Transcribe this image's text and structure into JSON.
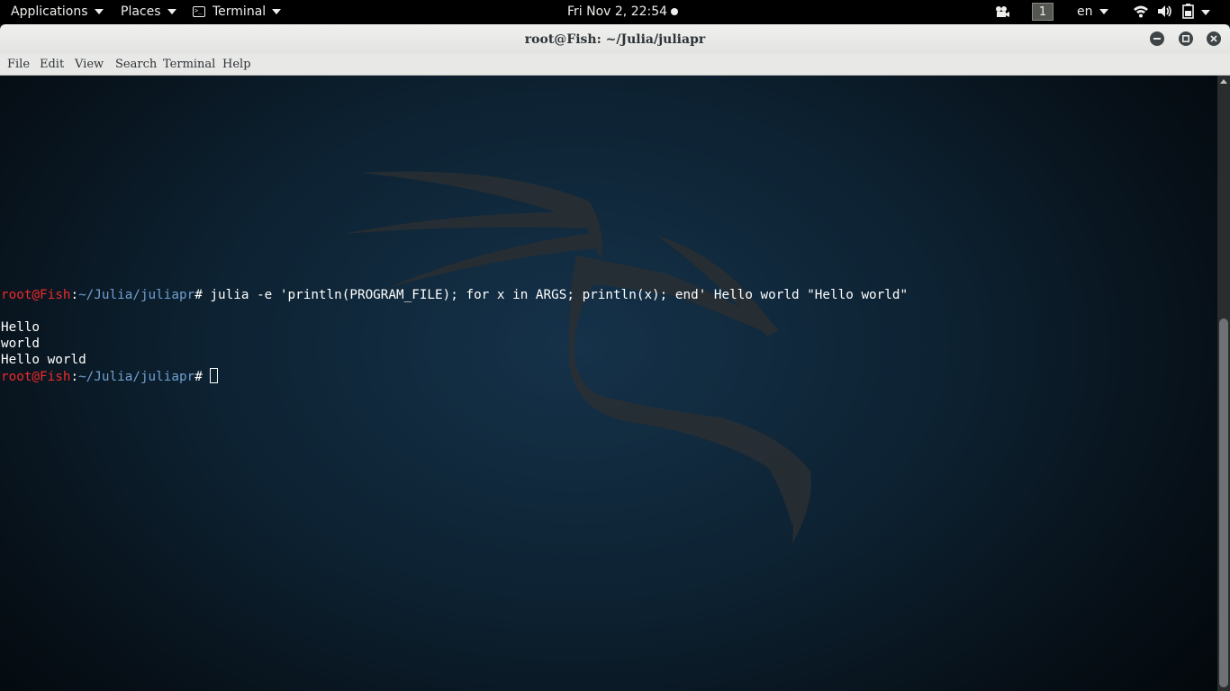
{
  "topbar": {
    "applications": "Applications",
    "places": "Places",
    "app_name": "Terminal",
    "clock": "Fri Nov  2, 22:54",
    "workspace": "1",
    "language": "en"
  },
  "window": {
    "title": "root@Fish: ~/Julia/juliapr"
  },
  "menubar": {
    "items": [
      "File",
      "Edit",
      "View",
      "Search",
      "Terminal",
      "Help"
    ]
  },
  "terminal": {
    "prompt_user": "root@Fish",
    "prompt_sep": ":",
    "prompt_path": "~/Julia/juliapr",
    "prompt_char": "# ",
    "command": "julia -e 'println(PROGRAM_FILE); for x in ARGS; println(x); end' Hello world \"Hello world\"",
    "output": [
      "",
      "Hello",
      "world",
      "Hello world"
    ]
  },
  "icons": {
    "window_close": "close-icon",
    "window_minimize": "minimize-icon",
    "window_maximize": "maximize-icon",
    "wifi": "wifi-icon",
    "volume": "volume-icon",
    "battery": "battery-icon",
    "video": "video-camera-icon"
  }
}
